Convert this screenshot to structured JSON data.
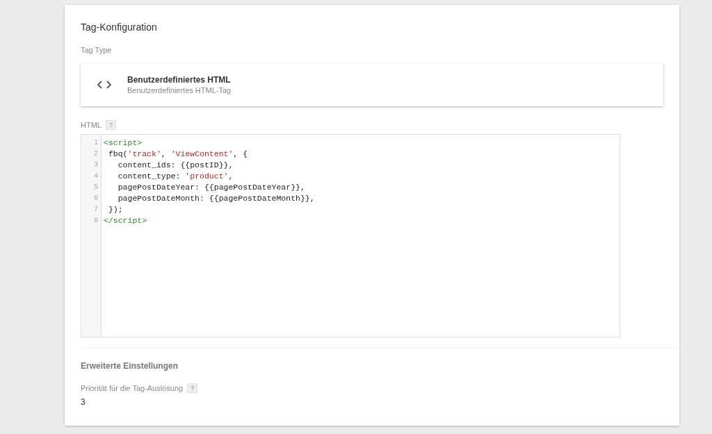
{
  "section_title": "Tag-Konfiguration",
  "tag_type": {
    "label": "Tag Type",
    "name": "Benutzerdefiniertes HTML",
    "description": "Benutzerdefiniertes HTML-Tag"
  },
  "html_field": {
    "label": "HTML",
    "help": "?",
    "lines": [
      {
        "number": "1",
        "tokens": [
          {
            "kind": "tag",
            "text": "<script>"
          }
        ]
      },
      {
        "number": "2",
        "tokens": [
          {
            "kind": "plain",
            "text": " fbq("
          },
          {
            "kind": "string",
            "text": "'track'"
          },
          {
            "kind": "plain",
            "text": ", "
          },
          {
            "kind": "string",
            "text": "'ViewContent'"
          },
          {
            "kind": "plain",
            "text": ", {"
          }
        ]
      },
      {
        "number": "3",
        "tokens": [
          {
            "kind": "plain",
            "text": "   content_ids: {{postID}},"
          }
        ]
      },
      {
        "number": "4",
        "tokens": [
          {
            "kind": "plain",
            "text": "   content_type: "
          },
          {
            "kind": "string",
            "text": "'product'"
          },
          {
            "kind": "plain",
            "text": ","
          }
        ]
      },
      {
        "number": "5",
        "tokens": [
          {
            "kind": "plain",
            "text": "   pagePostDateYear: {{pagePostDateYear}},"
          }
        ]
      },
      {
        "number": "6",
        "tokens": [
          {
            "kind": "plain",
            "text": "   pagePostDateMonth: {{pagePostDateMonth}},"
          }
        ]
      },
      {
        "number": "7",
        "tokens": [
          {
            "kind": "plain",
            "text": " });"
          }
        ]
      },
      {
        "number": "8",
        "tokens": [
          {
            "kind": "tag",
            "text": "</script>"
          }
        ]
      }
    ]
  },
  "advanced": {
    "title": "Erweiterte Einstellungen",
    "priority_label": "Priorität für die Tag-Auslösung",
    "help": "?",
    "priority_value": "3"
  }
}
